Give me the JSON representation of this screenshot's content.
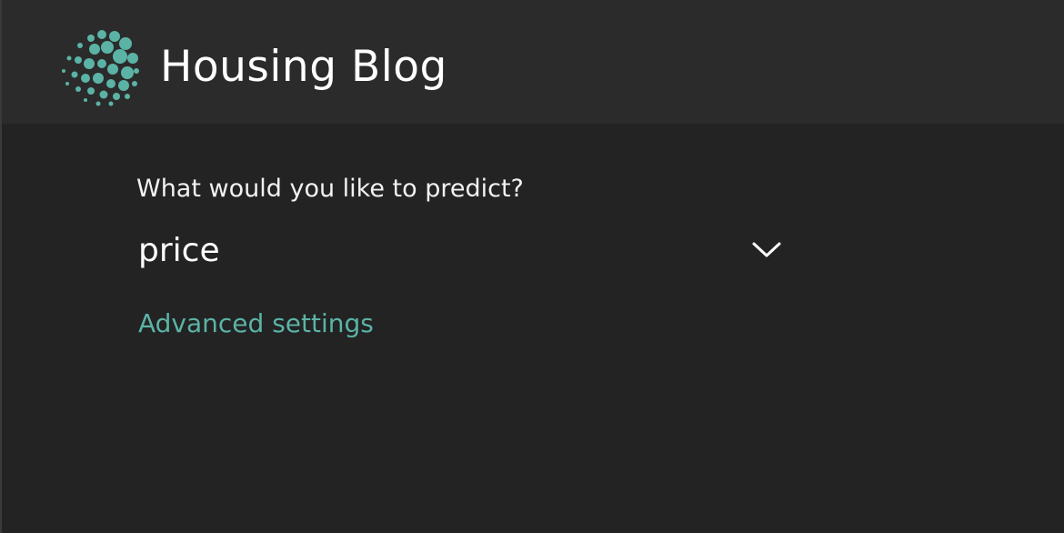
{
  "header": {
    "title": "Housing Blog",
    "logo_icon": "dotted-sphere-logo-icon"
  },
  "form": {
    "question": "What would you like to predict?",
    "target_select": {
      "value": "price",
      "icon": "chevron-down-icon"
    },
    "advanced_link": "Advanced settings"
  },
  "colors": {
    "background": "#232323",
    "header_background": "#2b2b2b",
    "accent": "#5bb3a6",
    "text": "#ffffff"
  }
}
